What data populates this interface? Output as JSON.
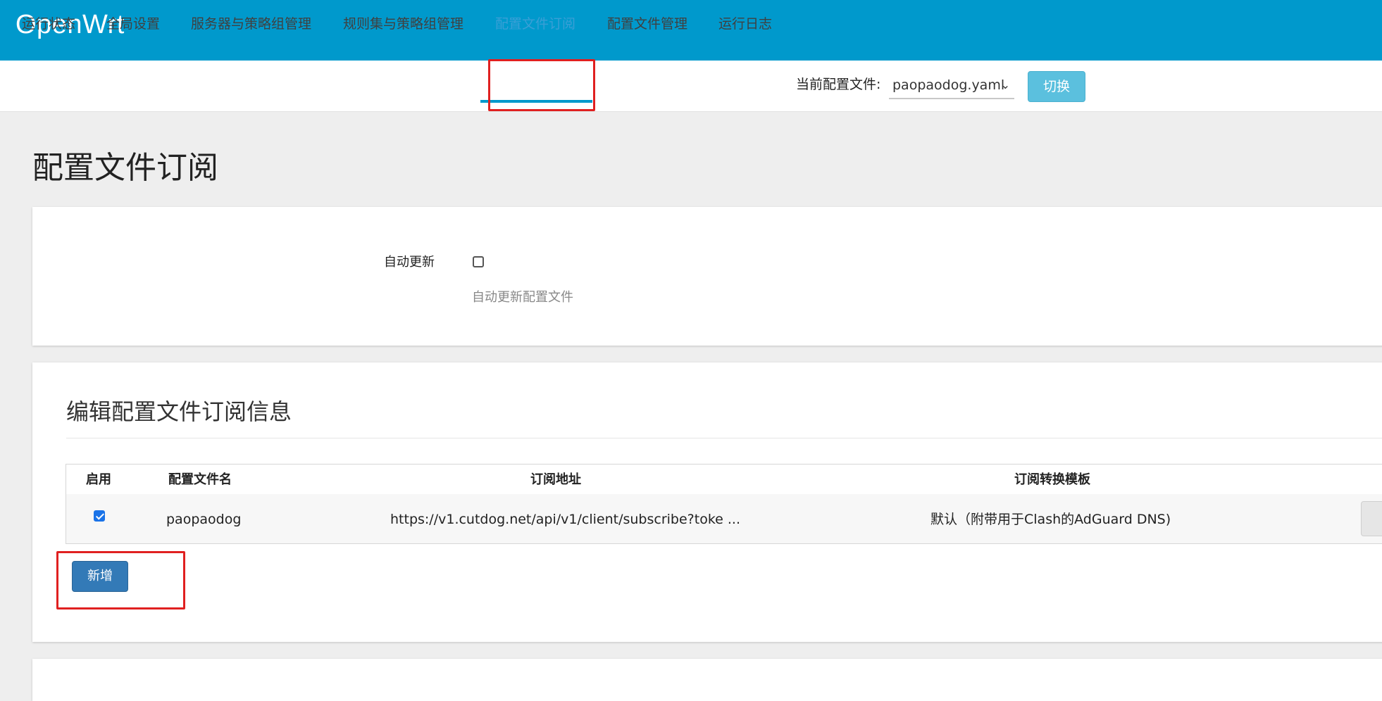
{
  "app": {
    "title": "OpenWrt"
  },
  "nav": {
    "tabs": [
      {
        "label": "运行状态"
      },
      {
        "label": "全局设置"
      },
      {
        "label": "服务器与策略组管理"
      },
      {
        "label": "规则集与策略组管理"
      },
      {
        "label": "配置文件订阅",
        "active": true
      },
      {
        "label": "配置文件管理"
      },
      {
        "label": "运行日志"
      }
    ],
    "current_profile_label": "当前配置文件:",
    "current_profile_value": "paopaodog.yaml",
    "switch_label": "切换"
  },
  "page": {
    "title": "配置文件订阅"
  },
  "auto_update": {
    "label": "自动更新",
    "checked": false,
    "description": "自动更新配置文件"
  },
  "subscriptions": {
    "section_title": "编辑配置文件订阅信息",
    "columns": [
      "启用",
      "配置文件名",
      "订阅地址",
      "订阅转换模板"
    ],
    "rows": [
      {
        "enabled": true,
        "name": "paopaodog",
        "url": "https://v1.cutdog.net/api/v1/client/subscribe?toke ...",
        "template": "默认（附带用于Clash的AdGuard DNS)"
      }
    ],
    "add_label": "新增"
  },
  "colors": {
    "header_bg": "#0099cc",
    "active_tab": "#3a9fd6",
    "switch_button": "#5bc0de",
    "add_button": "#337ab7",
    "annotation": "#e02020"
  }
}
